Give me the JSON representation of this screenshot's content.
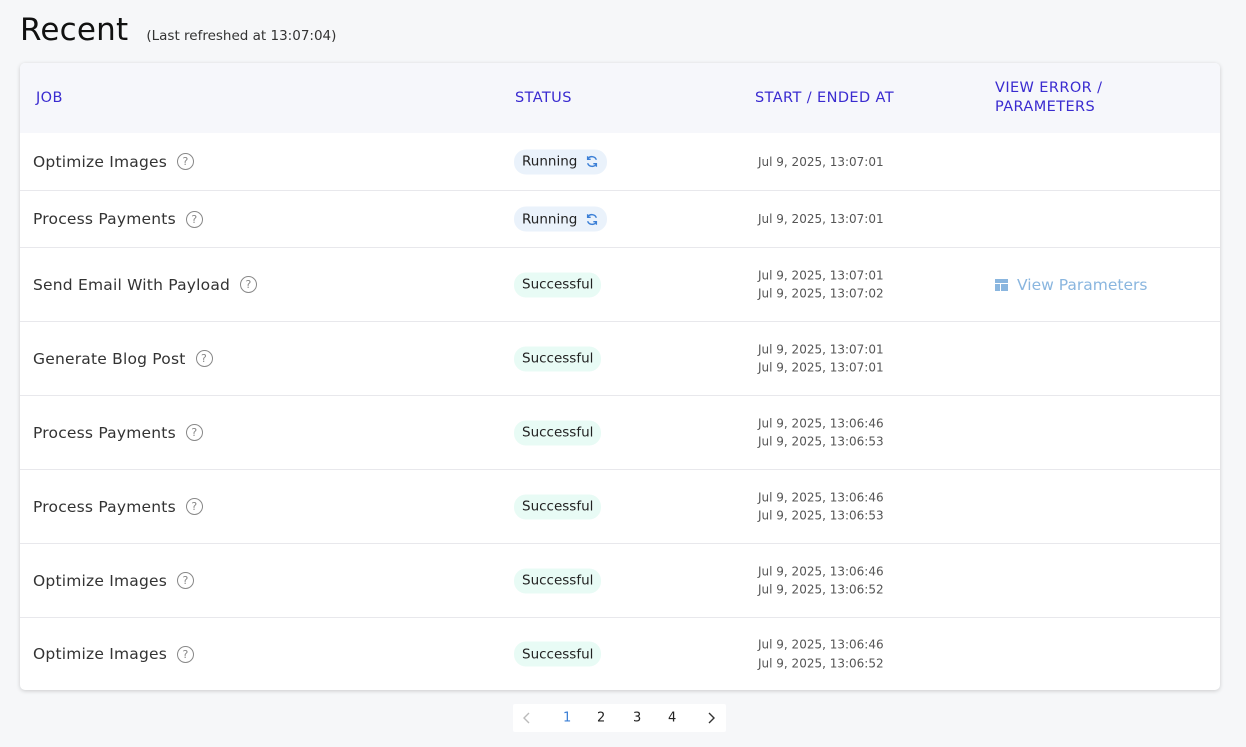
{
  "header": {
    "title": "Recent",
    "subtitle": "(Last refreshed at 13:07:04)"
  },
  "table": {
    "columns": {
      "job": "JOB",
      "status": "STATUS",
      "time": "START / ENDED AT",
      "view": "VIEW ERROR / PARAMETERS"
    },
    "rows": [
      {
        "job": "Optimize Images",
        "status": "Running",
        "status_kind": "running",
        "start": "Jul 9, 2025, 13:07:01",
        "end": "",
        "view": ""
      },
      {
        "job": "Process Payments",
        "status": "Running",
        "status_kind": "running",
        "start": "Jul 9, 2025, 13:07:01",
        "end": "",
        "view": ""
      },
      {
        "job": "Send Email With Payload",
        "status": "Successful",
        "status_kind": "successful",
        "start": "Jul 9, 2025, 13:07:01",
        "end": "Jul 9, 2025, 13:07:02",
        "view": "View Parameters"
      },
      {
        "job": "Generate Blog Post",
        "status": "Successful",
        "status_kind": "successful",
        "start": "Jul 9, 2025, 13:07:01",
        "end": "Jul 9, 2025, 13:07:01",
        "view": ""
      },
      {
        "job": "Process Payments",
        "status": "Successful",
        "status_kind": "successful",
        "start": "Jul 9, 2025, 13:06:46",
        "end": "Jul 9, 2025, 13:06:53",
        "view": ""
      },
      {
        "job": "Process Payments",
        "status": "Successful",
        "status_kind": "successful",
        "start": "Jul 9, 2025, 13:06:46",
        "end": "Jul 9, 2025, 13:06:53",
        "view": ""
      },
      {
        "job": "Optimize Images",
        "status": "Successful",
        "status_kind": "successful",
        "start": "Jul 9, 2025, 13:06:46",
        "end": "Jul 9, 2025, 13:06:52",
        "view": ""
      },
      {
        "job": "Optimize Images",
        "status": "Successful",
        "status_kind": "successful",
        "start": "Jul 9, 2025, 13:06:46",
        "end": "Jul 9, 2025, 13:06:52",
        "view": ""
      }
    ]
  },
  "pagination": {
    "pages": [
      "1",
      "2",
      "3",
      "4"
    ],
    "current": "1"
  },
  "icons": {
    "help": "help-circle-icon",
    "running": "refresh-icon",
    "view": "layout-icon",
    "prev": "chevron-left-icon",
    "next": "chevron-right-icon"
  },
  "colors": {
    "header_text": "#3a2bd0",
    "running_badge": "#eaf2fb",
    "success_badge": "#e8fbf5",
    "link": "#8ab6df",
    "active_page": "#3b7fd6"
  }
}
